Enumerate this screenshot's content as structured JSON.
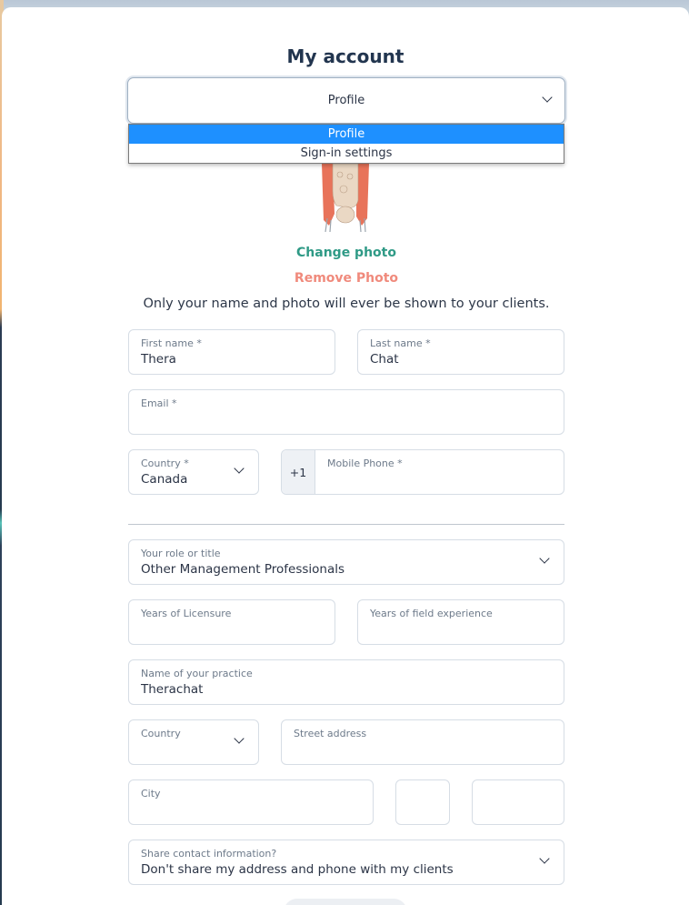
{
  "page": {
    "title": "My account"
  },
  "section_select": {
    "value": "Profile",
    "options": [
      {
        "label": "Profile",
        "selected": true
      },
      {
        "label": "Sign-in settings",
        "selected": false
      }
    ]
  },
  "photo": {
    "change_label": "Change photo",
    "remove_label": "Remove Photo",
    "note": "Only your name and photo will ever be shown to your clients."
  },
  "form": {
    "first_name": {
      "label": "First name *",
      "value": "Thera"
    },
    "last_name": {
      "label": "Last name *",
      "value": "Chat"
    },
    "email": {
      "label": "Email *",
      "value": ""
    },
    "country": {
      "label": "Country *",
      "value": "Canada"
    },
    "mobile_phone": {
      "label": "Mobile Phone *",
      "prefix": "+1",
      "value": ""
    },
    "role": {
      "label": "Your role or title",
      "value": "Other Management Professionals"
    },
    "years_licensure": {
      "label": "Years of Licensure",
      "value": ""
    },
    "years_experience": {
      "label": "Years of field experience",
      "value": ""
    },
    "practice_name": {
      "label": "Name of your practice",
      "value": "Therachat"
    },
    "practice_country": {
      "label": "Country",
      "value": ""
    },
    "street_address": {
      "label": "Street address",
      "value": ""
    },
    "city": {
      "label": "City",
      "value": ""
    },
    "share_contact": {
      "label": "Share contact information?",
      "value": "Don't share my address and phone with my clients"
    }
  },
  "colors": {
    "accent_blue": "#1e90ff",
    "change_photo_teal": "#2f9a86",
    "remove_photo_coral": "#f08a7c",
    "title_navy": "#22354f"
  }
}
